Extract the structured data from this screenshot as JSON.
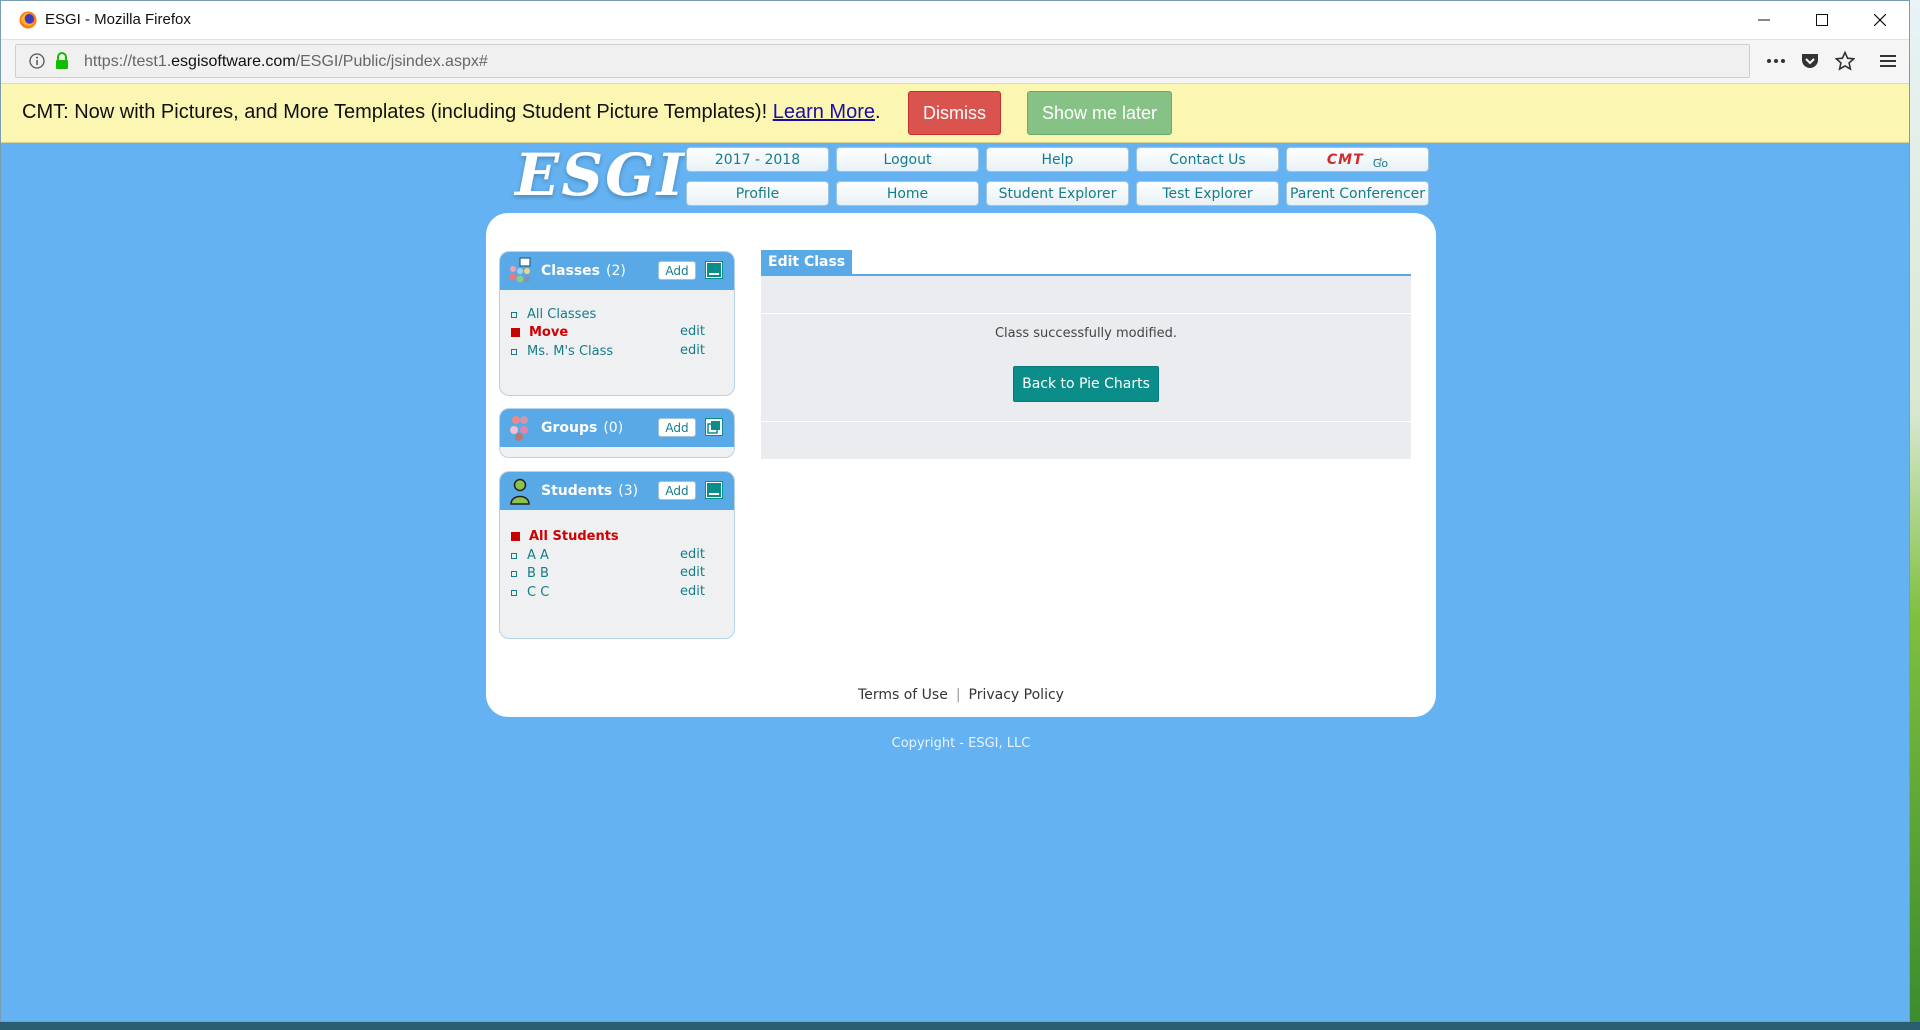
{
  "browser": {
    "window_title": "ESGI - Mozilla Firefox",
    "url_prefix": "https://test1.",
    "url_domain": "esgisoftware.com",
    "url_path": "/ESGI/Public/jsindex.aspx#"
  },
  "notification": {
    "text": "CMT: Now with Pictures, and More Templates (including Student Picture Templates)! ",
    "link": "Learn More",
    "after_link": ".",
    "dismiss_label": "Dismiss",
    "later_label": "Show me later",
    "colors": {
      "background": "#fbf6b1",
      "dismiss": "#d9534f",
      "later": "#86c285"
    }
  },
  "header": {
    "logo": "ESGI",
    "nav_row1": [
      "2017 - 2018",
      "Logout",
      "Help",
      "Contact Us"
    ],
    "cmt_logo": "CMT",
    "cmt_go": "Go",
    "nav_row2": [
      "Profile",
      "Home",
      "Student Explorer",
      "Test Explorer",
      "Parent Conferencer"
    ]
  },
  "sidebar": {
    "classes": {
      "title": "Classes",
      "count": "(2)",
      "add_label": "Add",
      "items": [
        {
          "label": "All Classes",
          "selected": false,
          "edit": ""
        },
        {
          "label": "Move",
          "selected": true,
          "edit": "edit"
        },
        {
          "label": "Ms. M's Class",
          "selected": false,
          "edit": "edit"
        }
      ]
    },
    "groups": {
      "title": "Groups",
      "count": "(0)",
      "add_label": "Add"
    },
    "students": {
      "title": "Students",
      "count": "(3)",
      "add_label": "Add",
      "items": [
        {
          "label": "All Students",
          "selected": true,
          "edit": ""
        },
        {
          "label": "A A",
          "selected": false,
          "edit": "edit"
        },
        {
          "label": "B B",
          "selected": false,
          "edit": "edit"
        },
        {
          "label": "C C",
          "selected": false,
          "edit": "edit"
        }
      ]
    }
  },
  "main": {
    "tab_label": "Edit Class",
    "message": "Class successfully modified.",
    "back_button": "Back to Pie Charts"
  },
  "footer": {
    "terms": "Terms of Use",
    "separator": "|",
    "privacy": "Privacy Policy",
    "copyright": "Copyright - ESGI, LLC"
  },
  "theme": {
    "page_bg": "#64b2f1",
    "accent": "#58a9e6",
    "link": "#167c8a",
    "selected": "#d10000",
    "button": "#0b8e8a"
  }
}
